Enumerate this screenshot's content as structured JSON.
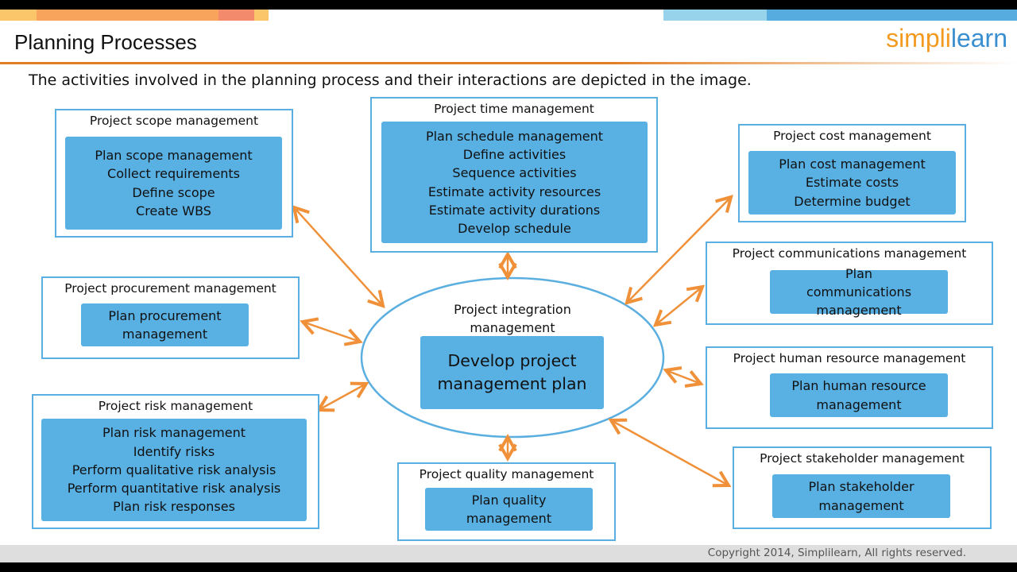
{
  "header": {
    "title": "Planning Processes",
    "subtitle": "The activities involved in the planning process and their interactions are depicted in the image.",
    "logo": "simplilearn"
  },
  "colors": {
    "box_border": "#5aaee0",
    "box_fill": "#58b0e3",
    "arrow": "#f0913a",
    "rule": "#e07f24"
  },
  "center": {
    "title": "Project integration management",
    "process": "Develop project management plan"
  },
  "areas": [
    {
      "title": "Project scope management",
      "processes": [
        "Plan scope management",
        "Collect requirements",
        "Define scope",
        "Create WBS"
      ]
    },
    {
      "title": "Project time management",
      "processes": [
        "Plan schedule management",
        "Define activities",
        "Sequence activities",
        "Estimate activity resources",
        "Estimate activity durations",
        "Develop schedule"
      ]
    },
    {
      "title": "Project cost management",
      "processes": [
        "Plan cost management",
        "Estimate costs",
        "Determine budget"
      ]
    },
    {
      "title": "Project communications management",
      "processes": [
        "Plan communications management"
      ]
    },
    {
      "title": "Project human resource management",
      "processes": [
        "Plan human resource management"
      ]
    },
    {
      "title": "Project stakeholder management",
      "processes": [
        "Plan stakeholder management"
      ]
    },
    {
      "title": "Project quality management",
      "processes": [
        "Plan quality management"
      ]
    },
    {
      "title": "Project risk management",
      "processes": [
        "Plan risk management",
        "Identify risks",
        "Perform qualitative risk analysis",
        "Perform quantitative risk analysis",
        "Plan risk responses"
      ]
    },
    {
      "title": "Project procurement management",
      "processes": [
        "Plan procurement management"
      ]
    }
  ],
  "footer": {
    "copyright": "Copyright 2014, Simplilearn, All rights reserved."
  }
}
